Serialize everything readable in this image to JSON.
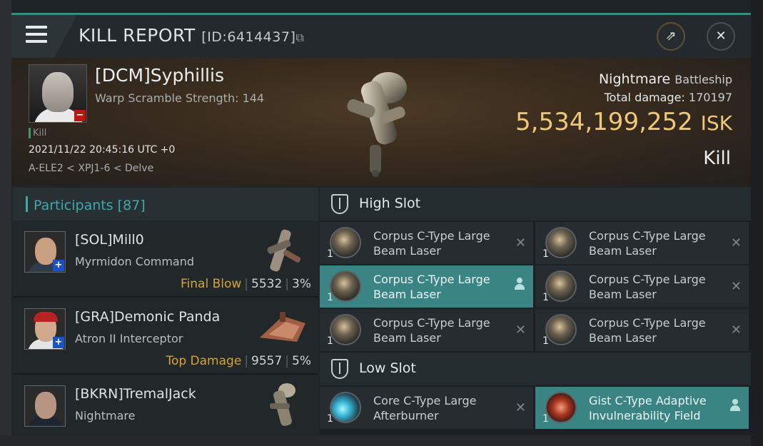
{
  "window": {
    "title": "KILL REPORT",
    "id_text": "[ID:6414437]",
    "copy_icon": "copy-icon",
    "share_icon": "external-link-icon",
    "close_icon": "close-icon",
    "accent_color": "#3a8a88"
  },
  "victim": {
    "name": "[DCM]Syphillis",
    "scramble": "Warp Scramble Strength: 144",
    "kill_tag": "Kill",
    "datetime": "2021/11/22 20:45:16 UTC +0",
    "location": "A-ELE2 < XPJ1-6 < Delve",
    "ship_name": "Nightmare",
    "ship_class": "Battleship",
    "total_damage_label": "Total damage:",
    "total_damage_value": "170197",
    "isk_value": "5,534,199,252",
    "isk_unit": "ISK",
    "result": "Kill",
    "isk_color": "#f0c873"
  },
  "participants": {
    "label": "Participants",
    "count": "[87]",
    "rows": [
      {
        "name": "[SOL]Mill0",
        "ship": "Myrmidon Command",
        "tag": "Final Blow",
        "damage": "5532",
        "percent": "3%"
      },
      {
        "name": "[GRA]Demonic Panda",
        "ship": "Atron II Interceptor",
        "tag": "Top Damage",
        "damage": "9557",
        "percent": "5%"
      },
      {
        "name": "[BKRN]TremalJack",
        "ship": "Nightmare",
        "tag": "",
        "damage": "",
        "percent": ""
      }
    ]
  },
  "slots": {
    "high": {
      "label": "High Slot",
      "modules": [
        {
          "qty": "1",
          "name": "Corpus C-Type Large Beam Laser"
        },
        {
          "qty": "1",
          "name": "Corpus C-Type Large Beam Laser"
        },
        {
          "qty": "1",
          "name": "Corpus C-Type Large Beam Laser"
        },
        {
          "qty": "1",
          "name": "Corpus C-Type Large Beam Laser"
        },
        {
          "qty": "1",
          "name": "Corpus C-Type Large Beam Laser"
        },
        {
          "qty": "1",
          "name": "Corpus C-Type Large Beam Laser"
        }
      ]
    },
    "low": {
      "label": "Low Slot",
      "modules": [
        {
          "qty": "1",
          "name": "Core C-Type Large Afterburner"
        },
        {
          "qty": "1",
          "name": "Gist C-Type Adaptive Invulnerability Field"
        }
      ]
    }
  }
}
